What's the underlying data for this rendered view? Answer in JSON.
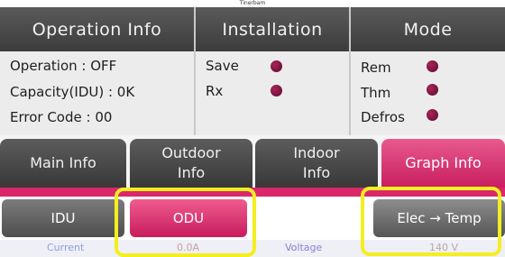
{
  "window_title": "Tinerbam",
  "headers": {
    "operation": "Operation Info",
    "installation": "Installation",
    "mode": "Mode"
  },
  "operation": {
    "status": "Operation : OFF",
    "capacity": "Capacity(IDU) : 0K",
    "error": "Error Code : 00"
  },
  "installation": {
    "items": [
      {
        "label": "Save",
        "indicator": "dot-icon"
      },
      {
        "label": "Rx",
        "indicator": "dot-icon"
      }
    ]
  },
  "mode": {
    "items": [
      {
        "label": "Rem",
        "indicator": "dot-icon"
      },
      {
        "label": "Thm",
        "indicator": "dot-icon"
      },
      {
        "label": "Defros",
        "indicator": "dot-icon"
      }
    ]
  },
  "tabs": [
    {
      "label": "Main Info",
      "active": false
    },
    {
      "label": "Outdoor Info",
      "active": false
    },
    {
      "label": "Indoor Info",
      "active": false
    },
    {
      "label": "Graph Info",
      "active": true
    }
  ],
  "buttons": {
    "idu": "IDU",
    "odu": "ODU",
    "elec_temp": "Elec → Temp"
  },
  "bottom_row": {
    "current_label": "Current",
    "current_value": "0.0A",
    "voltage_label": "Voltage",
    "voltage_value": "140 V"
  },
  "colors": {
    "header_bg": "#4a4a4a",
    "accent_pink": "#d9286a",
    "indicator": "#8a1240",
    "highlight": "#f4ee1f"
  }
}
